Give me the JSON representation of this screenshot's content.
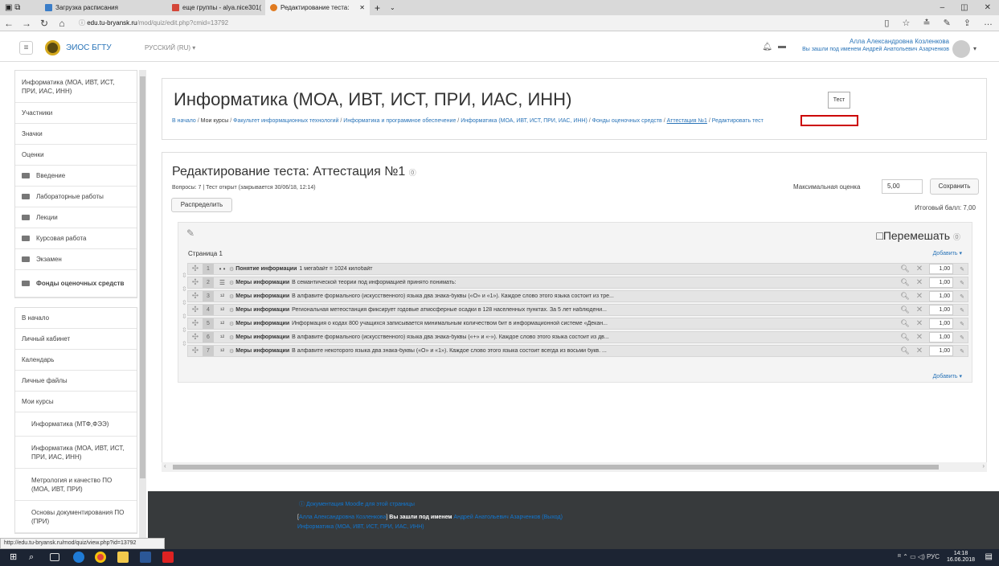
{
  "browser": {
    "tabs": [
      {
        "label": "Загрузка расписания",
        "color": "#3a7dc8"
      },
      {
        "label": "еще группы - alya.nice301(",
        "color": "#d44638"
      },
      {
        "label": "Редактирование теста:",
        "color": "#e07a1f"
      }
    ],
    "url_host": "edu.tu-bryansk.ru",
    "url_path": "/mod/quiz/edit.php?cmid=13792"
  },
  "header": {
    "site_name": "ЭИОС БГТУ",
    "lang": "РУССКИЙ (RU) ▾",
    "user_name": "Алла Александровна Козленкова",
    "login_as": "Вы зашли под именем Андрей Анатольевич Азарченков"
  },
  "sidebar": {
    "top": [
      {
        "label": "Информатика (МОА, ИВТ, ИСТ, ПРИ, ИАС, ИНН)",
        "tall": true
      },
      {
        "label": "Участники"
      },
      {
        "label": "Значки"
      },
      {
        "label": "Оценки"
      }
    ],
    "sections": [
      "Введение",
      "Лабораторные работы",
      "Лекции",
      "Курсовая работа",
      "Экзамен",
      "Фонды оценочных средств"
    ],
    "nav": [
      "В начало",
      "Личный кабинет",
      "Календарь",
      "Личные файлы",
      "Мои курсы"
    ],
    "courses": [
      "Информатика (МТФ,ФЭЭ)",
      "Информатика (МОА, ИВТ, ИСТ, ПРИ, ИАС, ИНН)",
      "Метрология и качество ПО (МОА, ИВТ, ПРИ)",
      "Основы документирования ПО (ПРИ)"
    ]
  },
  "course": {
    "title": "Информатика (МОА, ИВТ, ИСТ, ПРИ, ИАС, ИНН)",
    "tooltip": "Тест",
    "breadcrumbs": [
      "В начало",
      "Мои курсы",
      "Факультет информационных технологий",
      "Информатика и программное обеспечение",
      "Информатика (МОА, ИВТ, ИСТ, ПРИ, ИАС, ИНН)",
      "Фонды оценочных средств",
      "Аттестация №1",
      "Редактировать тест"
    ]
  },
  "quiz": {
    "title": "Редактирование теста: Аттестация №1",
    "summary": "Вопросы: 7 | Тест открыт (закрывается 30/06/18, 12:14)",
    "distribute_label": "Распределить",
    "max_grade_label": "Максимальная оценка",
    "max_grade_value": "5,00",
    "save_label": "Сохранить",
    "total": "Итоговый балл: 7,00",
    "shuffle_label": "□Перемешать",
    "page_label": "Страница 1",
    "add_label": "Добавить ▾",
    "questions": [
      {
        "n": "1",
        "icon": "• •",
        "name": "Понятие информации",
        "text": "1 мегабайт = 1024 килобайт",
        "mark": "1,00"
      },
      {
        "n": "2",
        "icon": "☰",
        "name": "Меры информации",
        "text": "В семантической теории под информацией принято понимать:",
        "mark": "1,00"
      },
      {
        "n": "3",
        "icon": "¹²",
        "name": "Меры информации",
        "text": "В алфавите формального (искусственного) языка два знака-буквы («О» и «1»). Каждое слово этого языка состоит из тре...",
        "mark": "1,00"
      },
      {
        "n": "4",
        "icon": "¹²",
        "name": "Меры информации",
        "text": "Региональная метеостанция фиксирует годовые атмосферные осадки в 128 населенных пунктах. За 5 лет наблюдени...",
        "mark": "1,00"
      },
      {
        "n": "5",
        "icon": "¹²",
        "name": "Меры информации",
        "text": "Информация о кодах 800 учащихся записывается минимальным количеством бит в информационной системе «Декан...",
        "mark": "1,00"
      },
      {
        "n": "6",
        "icon": "¹²",
        "name": "Меры информации",
        "text": "В алфавите формального (искусственного) языка два знака-буквы («+» и «-»). Каждое слово этого языка состоит из дв...",
        "mark": "1,00"
      },
      {
        "n": "7",
        "icon": "¹²",
        "name": "Меры информации",
        "text": "В алфавите некоторого языка два знака-буквы («О» и «1»). Каждое слово этого языка состоит всегда из восьми букв. ...",
        "mark": "1,00"
      }
    ]
  },
  "footer": {
    "docs": "ⓘ Документация Moodle для этой страницы",
    "user_link": "Алла Александровна Козленкова",
    "login_as_text": "Вы зашли под именем",
    "as_user": "Андрей Анатольевич Азарченков",
    "logout": "(Выход)",
    "course_link": "Информатика (МОА, ИВТ, ИСТ, ПРИ, ИАС, ИНН)"
  },
  "status_url": "http://edu.tu-bryansk.ru/mod/quiz/view.php?id=13792",
  "taskbar": {
    "lang": "РУС",
    "time": "14:18",
    "date": "16.06.2018"
  }
}
